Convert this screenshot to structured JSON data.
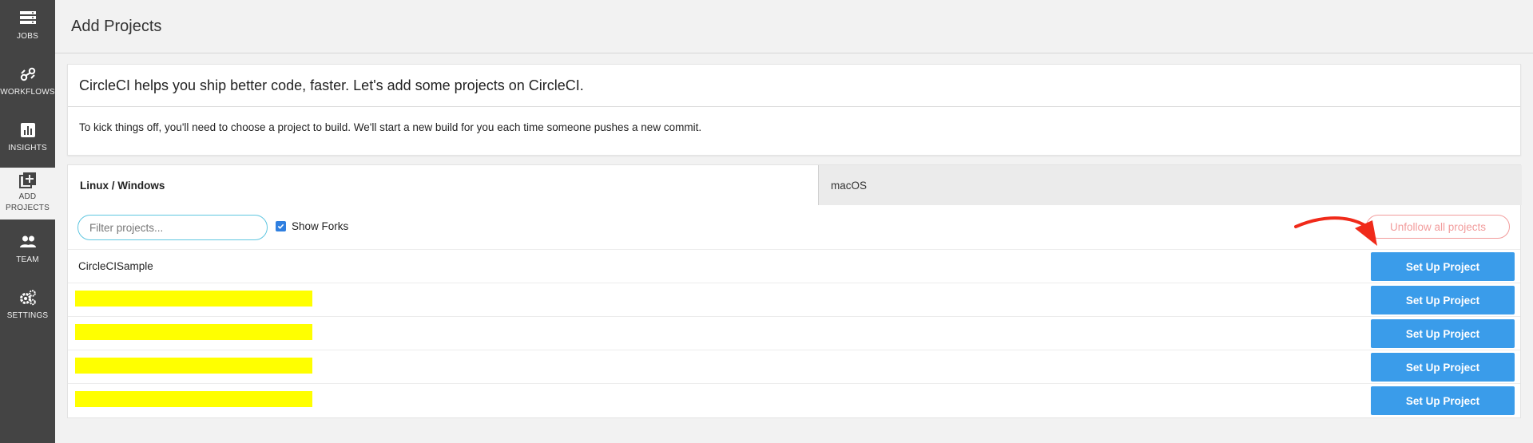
{
  "sidebar": {
    "items": [
      {
        "label": "JOBS",
        "icon": "jobs-icon"
      },
      {
        "label": "WORKFLOWS",
        "icon": "workflows-icon"
      },
      {
        "label": "INSIGHTS",
        "icon": "insights-icon"
      },
      {
        "label": "ADD PROJECTS",
        "icon": "add-projects-icon",
        "active": true
      },
      {
        "label": "TEAM",
        "icon": "team-icon"
      },
      {
        "label": "SETTINGS",
        "icon": "settings-icon"
      }
    ]
  },
  "header": {
    "title": "Add Projects"
  },
  "intro": {
    "title": "CircleCI helps you ship better code, faster. Let's add some projects on CircleCI.",
    "text": "To kick things off, you'll need to choose a project to build. We'll start a new build for you each time someone pushes a new commit."
  },
  "tabs": [
    {
      "label": "Linux / Windows",
      "active": true
    },
    {
      "label": "macOS",
      "active": false
    }
  ],
  "toolbar": {
    "filter_placeholder": "Filter projects...",
    "show_forks_label": "Show Forks",
    "show_forks_checked": true,
    "unfollow_label": "Unfollow all projects"
  },
  "projects": [
    {
      "name": "CircleCISample",
      "button": "Set Up Project",
      "redacted": false
    },
    {
      "name": "",
      "button": "Set Up Project",
      "redacted": true
    },
    {
      "name": "",
      "button": "Set Up Project",
      "redacted": true
    },
    {
      "name": "",
      "button": "Set Up Project",
      "redacted": true
    },
    {
      "name": "",
      "button": "Set Up Project",
      "redacted": true
    }
  ],
  "colors": {
    "sidebar": "#444444",
    "accent_blue": "#3a9cea",
    "unfollow_red": "#f29c9c",
    "redaction": "#ffff00",
    "annotation_arrow": "#f02a1a"
  }
}
